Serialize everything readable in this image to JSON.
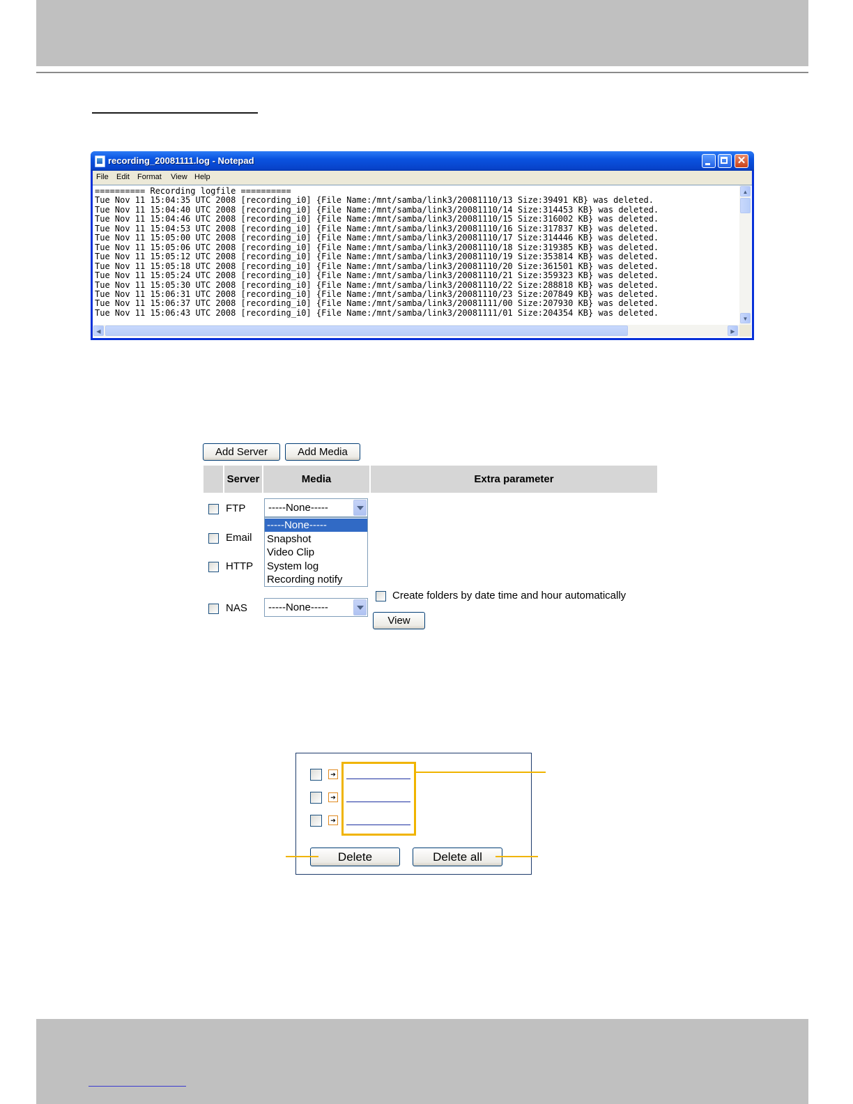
{
  "notepad": {
    "title": "recording_20081111.log - Notepad",
    "menu": [
      "File",
      "Edit",
      "Format",
      "View",
      "Help"
    ],
    "content": "========== Recording logfile ==========\nTue Nov 11 15:04:35 UTC 2008 [recording_i0] {File Name:/mnt/samba/link3/20081110/13 Size:39491 KB} was deleted.\nTue Nov 11 15:04:40 UTC 2008 [recording_i0] {File Name:/mnt/samba/link3/20081110/14 Size:314453 KB} was deleted.\nTue Nov 11 15:04:46 UTC 2008 [recording_i0] {File Name:/mnt/samba/link3/20081110/15 Size:316002 KB} was deleted.\nTue Nov 11 15:04:53 UTC 2008 [recording_i0] {File Name:/mnt/samba/link3/20081110/16 Size:317837 KB} was deleted.\nTue Nov 11 15:05:00 UTC 2008 [recording_i0] {File Name:/mnt/samba/link3/20081110/17 Size:314446 KB} was deleted.\nTue Nov 11 15:05:06 UTC 2008 [recording_i0] {File Name:/mnt/samba/link3/20081110/18 Size:319385 KB} was deleted.\nTue Nov 11 15:05:12 UTC 2008 [recording_i0] {File Name:/mnt/samba/link3/20081110/19 Size:353814 KB} was deleted.\nTue Nov 11 15:05:18 UTC 2008 [recording_i0] {File Name:/mnt/samba/link3/20081110/20 Size:361501 KB} was deleted.\nTue Nov 11 15:05:24 UTC 2008 [recording_i0] {File Name:/mnt/samba/link3/20081110/21 Size:359323 KB} was deleted.\nTue Nov 11 15:05:30 UTC 2008 [recording_i0] {File Name:/mnt/samba/link3/20081110/22 Size:288818 KB} was deleted.\nTue Nov 11 15:06:31 UTC 2008 [recording_i0] {File Name:/mnt/samba/link3/20081110/23 Size:207849 KB} was deleted.\nTue Nov 11 15:06:37 UTC 2008 [recording_i0] {File Name:/mnt/samba/link3/20081111/00 Size:207930 KB} was deleted.\nTue Nov 11 15:06:43 UTC 2008 [recording_i0] {File Name:/mnt/samba/link3/20081111/01 Size:204354 KB} was deleted."
  },
  "event_settings": {
    "buttons": {
      "add_server": "Add Server",
      "add_media": "Add Media",
      "view": "View"
    },
    "headers": {
      "server": "Server",
      "media": "Media",
      "extra": "Extra parameter"
    },
    "servers": [
      "FTP",
      "Email",
      "HTTP",
      "NAS"
    ],
    "ftp_media_value": "-----None-----",
    "nas_media_value": "-----None-----",
    "media_options": [
      "-----None-----",
      "Snapshot",
      "Video Clip",
      "System log",
      "Recording notify"
    ],
    "selected_option": "-----None-----",
    "auto_folder_label": "Create folders by date time and hour automatically"
  },
  "recording_list": {
    "delete_label": "Delete",
    "delete_all_label": "Delete all"
  },
  "colors": {
    "highlight": "#f0b400",
    "header_bg": "#d6d6d6",
    "selected_option_bg": "#316ac5",
    "titlebar": "#0a53e0"
  },
  "icons": [
    "notepad-icon",
    "minimize-icon",
    "maximize-icon",
    "close-icon",
    "scroll-arrow-icon",
    "dropdown-arrow-icon",
    "link-arrow-icon"
  ]
}
